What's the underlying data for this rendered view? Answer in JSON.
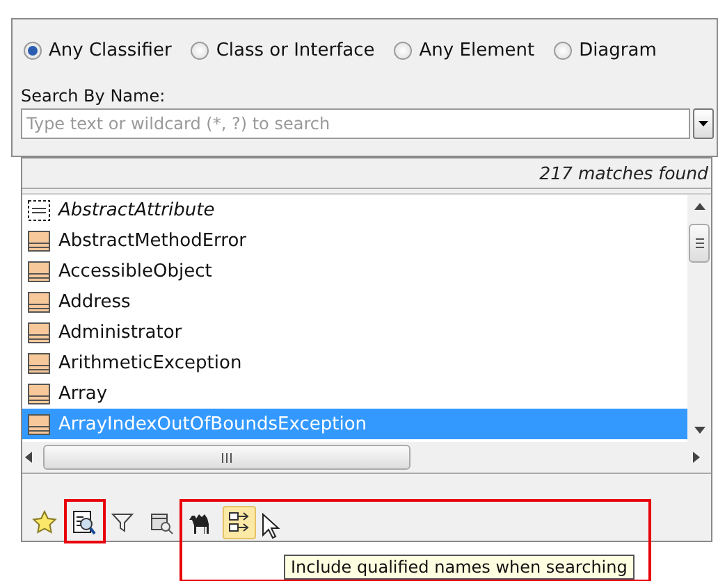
{
  "filters": [
    {
      "label": "Any Classifier",
      "selected": true
    },
    {
      "label": "Class or Interface",
      "selected": false
    },
    {
      "label": "Any Element",
      "selected": false
    },
    {
      "label": "Diagram",
      "selected": false
    }
  ],
  "search": {
    "label": "Search By Name:",
    "placeholder": "Type text or wildcard (*, ?) to search"
  },
  "results": {
    "count": "217 matches found",
    "items": [
      {
        "name": "AbstractAttribute",
        "kind": "abstract",
        "selected": false
      },
      {
        "name": "AbstractMethodError",
        "kind": "class",
        "selected": false
      },
      {
        "name": "AccessibleObject",
        "kind": "class",
        "selected": false
      },
      {
        "name": "Address",
        "kind": "class",
        "selected": false
      },
      {
        "name": "Administrator",
        "kind": "class",
        "selected": false
      },
      {
        "name": "ArithmeticException",
        "kind": "class",
        "selected": false
      },
      {
        "name": "Array",
        "kind": "class",
        "selected": false
      },
      {
        "name": "ArrayIndexOutOfBoundsException",
        "kind": "class",
        "selected": true
      }
    ]
  },
  "toolbar": [
    {
      "kind": "star",
      "pressed": false
    },
    {
      "kind": "search-results",
      "pressed": false
    },
    {
      "kind": "filter",
      "pressed": false
    },
    {
      "kind": "package-search",
      "pressed": false
    },
    {
      "kind": "camel",
      "pressed": false
    },
    {
      "kind": "qualified",
      "pressed": true
    }
  ],
  "tooltip": "Include qualified names when searching"
}
